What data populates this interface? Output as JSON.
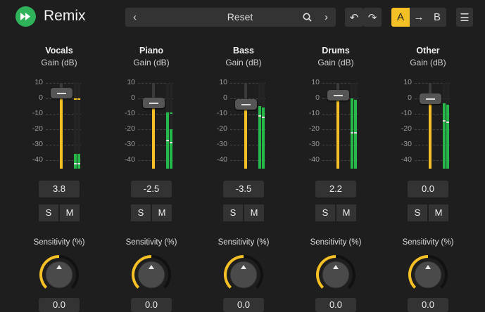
{
  "app": {
    "title": "Remix"
  },
  "preset": {
    "prev": "‹",
    "name": "Reset",
    "next": "›",
    "search_icon": "search-icon"
  },
  "toolbar": {
    "undo": "↶",
    "redo": "↷",
    "a": "A",
    "copy": "→",
    "b": "B",
    "menu": "☰"
  },
  "colors": {
    "accent": "#f4c025",
    "meter": "#27b84a",
    "logo": "#2fb25a"
  },
  "scale_labels": [
    "10",
    "0",
    "-10",
    "-20",
    "-30",
    "-40"
  ],
  "strips": [
    {
      "name": "Vocals",
      "sub": "Gain (dB)",
      "gain": "3.8",
      "gain_db": 3.8,
      "solo": "S",
      "mute": "M",
      "sens_label": "Sensitivity (%)",
      "sens_value": "0.0",
      "meter_l": -36,
      "meter_r": -36,
      "peak_l": -42,
      "peak_r": -42,
      "top_l": 0,
      "top_r": 0
    },
    {
      "name": "Piano",
      "sub": "Gain (dB)",
      "gain": "-2.5",
      "gain_db": -2.5,
      "solo": "S",
      "mute": "M",
      "sens_label": "Sensitivity (%)",
      "sens_value": "0.0",
      "meter_l": -9,
      "meter_r": -20,
      "peak_l": -27,
      "peak_r": -28,
      "top_l": -9,
      "top_r": -9
    },
    {
      "name": "Bass",
      "sub": "Gain (dB)",
      "gain": "-3.5",
      "gain_db": -3.5,
      "solo": "S",
      "mute": "M",
      "sens_label": "Sensitivity (%)",
      "sens_value": "0.0",
      "meter_l": -5,
      "meter_r": -6,
      "peak_l": -11,
      "peak_r": -12,
      "top_l": -5,
      "top_r": -6
    },
    {
      "name": "Drums",
      "sub": "Gain (dB)",
      "gain": "2.2",
      "gain_db": 2.2,
      "solo": "S",
      "mute": "M",
      "sens_label": "Sensitivity (%)",
      "sens_value": "0.0",
      "meter_l": 0,
      "meter_r": -1,
      "peak_l": -22,
      "peak_r": -22,
      "top_l": 0,
      "top_r": -1
    },
    {
      "name": "Other",
      "sub": "Gain (dB)",
      "gain": "0.0",
      "gain_db": 0.0,
      "solo": "S",
      "mute": "M",
      "sens_label": "Sensitivity (%)",
      "sens_value": "0.0",
      "meter_l": -3,
      "meter_r": -4,
      "peak_l": -14,
      "peak_r": -15,
      "top_l": -3,
      "top_r": -4
    }
  ],
  "knob_value_percent": 50
}
